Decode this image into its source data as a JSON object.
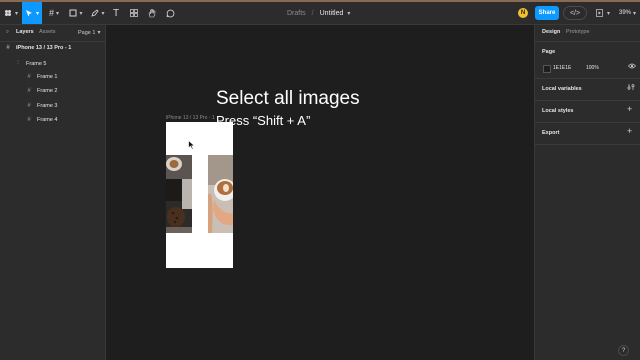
{
  "toolbar": {
    "location": "Drafts",
    "separator": "/",
    "file_name": "Untitled",
    "avatar_initial": "N",
    "share_label": "Share",
    "zoom": "39%",
    "accent": "#0d99ff"
  },
  "left_panel": {
    "tabs": [
      "Layers",
      "Assets"
    ],
    "page_selector": "Page 1",
    "layers": [
      {
        "label": "iPhone 13 / 13 Pro - 1",
        "icon": "frame-icon"
      },
      {
        "label": "Frame 5",
        "icon": "autolayout-icon"
      },
      {
        "label": "Frame 1",
        "icon": "frame-icon"
      },
      {
        "label": "Frame 2",
        "icon": "frame-icon"
      },
      {
        "label": "Frame 3",
        "icon": "frame-icon"
      },
      {
        "label": "Frame 4",
        "icon": "frame-icon"
      }
    ]
  },
  "canvas": {
    "heading": "Select all images",
    "subheading": "Press “Shift + A”",
    "frame_label": "iPhone 13 / 13 Pro - 1",
    "background": "#1e1e1e"
  },
  "right_panel": {
    "tabs": [
      "Design",
      "Prototype"
    ],
    "page_section": "Page",
    "page_color_hex": "1E1E1E",
    "page_opacity": "100%",
    "sections": [
      "Local variables",
      "Local styles",
      "Export"
    ]
  }
}
